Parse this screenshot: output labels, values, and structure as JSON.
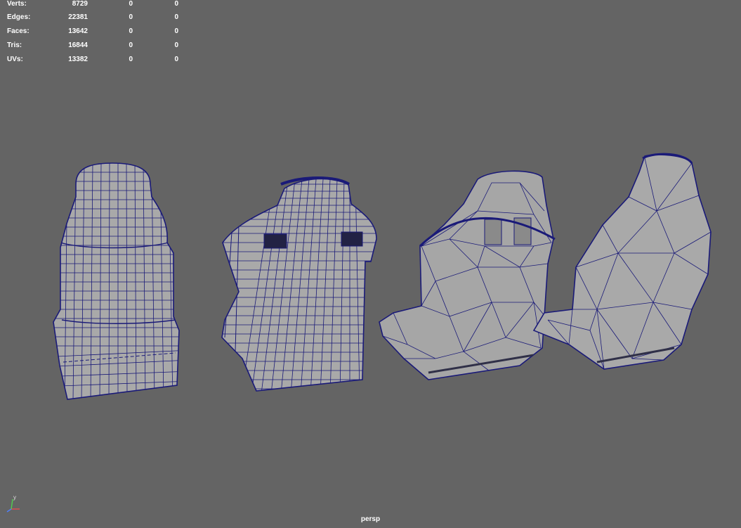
{
  "viewport": {
    "background": "#646464",
    "wire_color": "#1a1a78",
    "surface_color": "#aaaaaa",
    "camera": "persp"
  },
  "hud": {
    "rows": [
      {
        "label": "Verts:",
        "values": [
          "8729",
          "0",
          "0"
        ]
      },
      {
        "label": "Edges:",
        "values": [
          "22381",
          "0",
          "0"
        ]
      },
      {
        "label": "Faces:",
        "values": [
          "13642",
          "0",
          "0"
        ]
      },
      {
        "label": "Tris:",
        "values": [
          "16844",
          "0",
          "0"
        ]
      },
      {
        "label": "UVs:",
        "values": [
          "13382",
          "0",
          "0"
        ]
      }
    ]
  },
  "axis": {
    "y_label": "y",
    "icon": "axis-gizmo-icon"
  }
}
